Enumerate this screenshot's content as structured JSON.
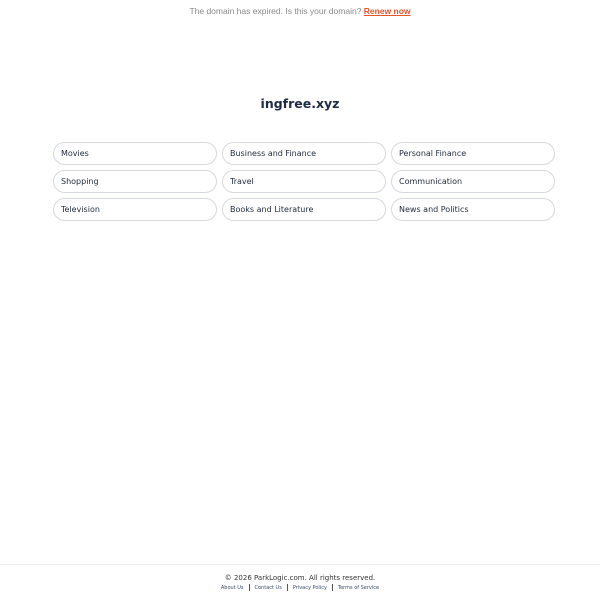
{
  "notice": {
    "text": "The domain has expired. Is this your domain?",
    "renew_label": "Renew now",
    "renew_color": "#e8532a"
  },
  "domain": {
    "name": "ingfree.xyz"
  },
  "links": [
    {
      "label": "Movies"
    },
    {
      "label": "Business and Finance"
    },
    {
      "label": "Personal Finance"
    },
    {
      "label": "Shopping"
    },
    {
      "label": "Travel"
    },
    {
      "label": "Communication"
    },
    {
      "label": "Television"
    },
    {
      "label": "Books and Literature"
    },
    {
      "label": "News and Politics"
    }
  ],
  "footer": {
    "copyright": "© 2026 ParkLogic.com. All rights reserved.",
    "links": [
      {
        "label": "About Us"
      },
      {
        "label": "Contact Us"
      },
      {
        "label": "Privacy Policy"
      },
      {
        "label": "Terms of Service"
      }
    ]
  }
}
